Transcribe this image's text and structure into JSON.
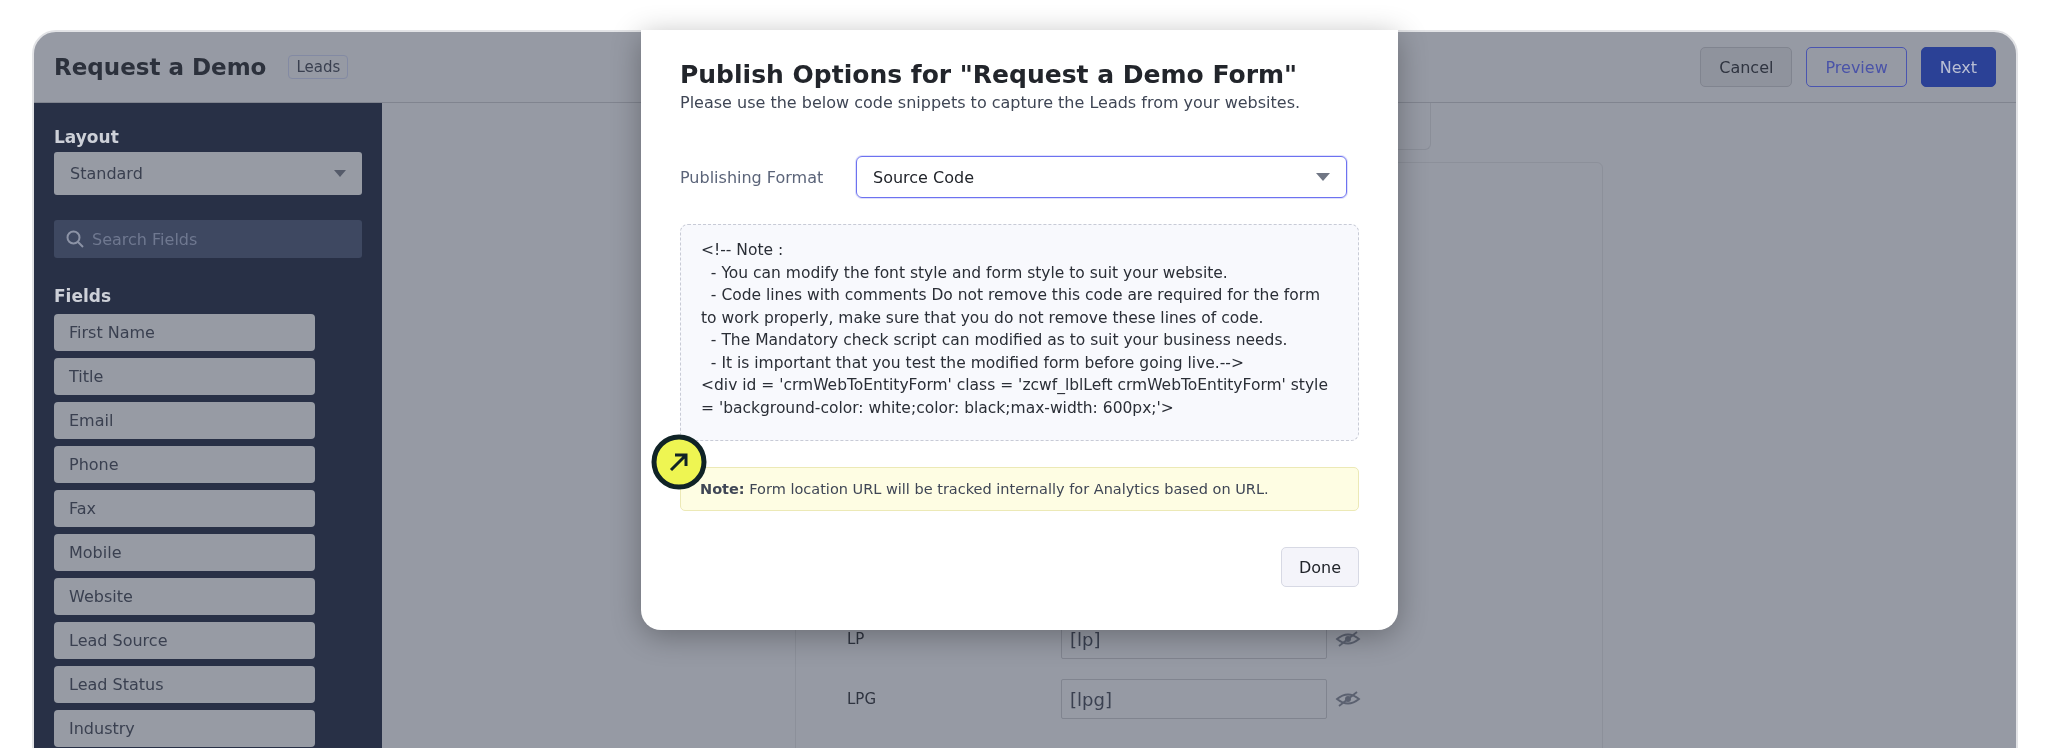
{
  "header": {
    "title": "Request a Demo",
    "badge": "Leads",
    "buttons": [
      {
        "label": "Cancel",
        "kind": "secondary"
      },
      {
        "label": "Preview",
        "kind": "outline"
      },
      {
        "label": "Next",
        "kind": "primary"
      }
    ]
  },
  "sidebar": {
    "layout_label": "Layout",
    "layout_value": "Standard",
    "search": {
      "placeholder": "Search Fields"
    },
    "fields_label": "Fields",
    "fields": [
      "First Name",
      "Title",
      "Email",
      "Phone",
      "Fax",
      "Mobile",
      "Website",
      "Lead Source",
      "Lead Status",
      "Industry"
    ]
  },
  "form_rows": [
    {
      "label": "LP",
      "value": "[lp]"
    },
    {
      "label": "LPG",
      "value": "[lpg]"
    }
  ],
  "dialog": {
    "title": "Publish Options for \"Request a Demo Form\"",
    "subtitle": "Please use the below code snippets to capture the Leads from your websites.",
    "format_label": "Publishing Format",
    "format_value": "Source Code",
    "code_lines": [
      "<!-- Note :",
      "  - You can modify the font style and form style to suit your website.",
      "  - Code lines with comments Do not remove this code are required for the form to work properly, make sure that you do not remove these lines of code.",
      "  - The Mandatory check script can modified as to suit your business needs.",
      "  - It is important that you test the modified form before going live.-->",
      "<div id = 'crmWebToEntityForm' class = 'zcwf_lblLeft crmWebToEntityForm' style = 'background-color: white;color: black;max-width: 600px;'>"
    ],
    "note": "**Note:** Form location URL will be tracked internally for Analytics based on URL.",
    "done": "Done"
  }
}
